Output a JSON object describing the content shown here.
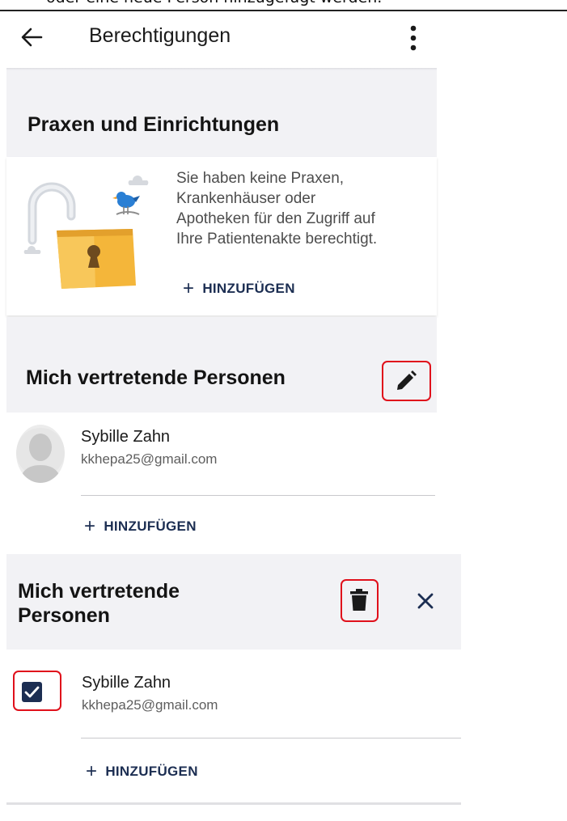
{
  "document": {
    "caption_fragment": "oder eine neue Person hinzugefügt werden."
  },
  "appbar": {
    "title": "Berechtigungen",
    "back_icon": "arrow-back-icon",
    "menu_icon": "more-vert-icon"
  },
  "practices": {
    "title": "Praxen und Einrichtungen",
    "empty_message": "Sie haben keine Praxen, Krankenhäuser oder Apotheken für den Zugriff auf Ihre Patientenakte berechtigt.",
    "empty_lines": [
      "Sie haben keine Praxen,",
      "Krankenhäuser oder",
      "Apotheken für den Zugriff auf",
      "Ihre Patientenakte berechtigt."
    ],
    "add_label": "HINZUFÜGEN",
    "illustration": "open-padlock-with-bird"
  },
  "representatives_view": {
    "title": "Mich vertretende Personen",
    "edit_icon": "pencil-edit-icon",
    "persons": [
      {
        "name": "Sybille Zahn",
        "email": "kkhepa25@gmail.com"
      }
    ],
    "add_label": "HINZUFÜGEN"
  },
  "representatives_edit": {
    "title_line1": "Mich vertretende",
    "title_line2": "Personen",
    "delete_icon": "trash-icon",
    "close_icon": "close-icon",
    "persons": [
      {
        "name": "Sybille Zahn",
        "email": "kkhepa25@gmail.com",
        "selected": true
      }
    ],
    "add_label": "HINZUFÜGEN"
  },
  "colors": {
    "accent": "#1c2e52",
    "highlight": "#e0101b",
    "section_bg": "#f2f2f5"
  }
}
